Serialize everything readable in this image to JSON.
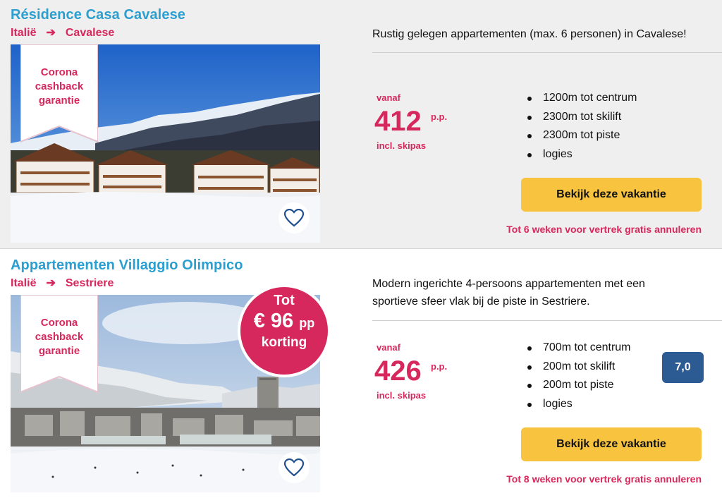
{
  "listings": [
    {
      "title": "Résidence Casa Cavalese",
      "country": "Italië",
      "arrow": "➔",
      "place": "Cavalese",
      "badge": "Corona cashback garantie",
      "description": "Rustig gelegen appartementen (max. 6 personen) in Cavalese!",
      "from_label": "vanaf",
      "price": "412",
      "per_person": "p.p.",
      "includes": "incl. skipas",
      "features": [
        "1200m tot centrum",
        "2300m tot skilift",
        "2300m tot piste",
        "logies"
      ],
      "button": "Bekijk deze vakantie",
      "cancellation": "Tot 6 weken voor vertrek gratis annuleren"
    },
    {
      "title": "Appartementen Villaggio Olimpico",
      "country": "Italië",
      "arrow": "➔",
      "place": "Sestriere",
      "badge": "Corona cashback garantie",
      "discount": {
        "line1": "Tot",
        "amount": "€ 96",
        "unit": "pp",
        "line3": "korting"
      },
      "description_line1": "Modern ingerichte 4-persoons appartementen met een",
      "description_line2": "sportieve sfeer vlak bij de piste in Sestriere.",
      "from_label": "vanaf",
      "price": "426",
      "per_person": "p.p.",
      "includes": "incl. skipas",
      "features": [
        "700m tot centrum",
        "200m tot skilift",
        "200m tot piste",
        "logies"
      ],
      "rating": "7,0",
      "button": "Bekijk deze vakantie",
      "cancellation": "Tot 8 weken voor vertrek gratis annuleren"
    }
  ],
  "icons": {
    "favorite": "heart-icon",
    "breadcrumb_separator": "arrow-right-icon"
  },
  "colors": {
    "title": "#2a9fd0",
    "accent": "#d6285d",
    "button": "#f8c33e",
    "rating": "#2c5a93"
  }
}
